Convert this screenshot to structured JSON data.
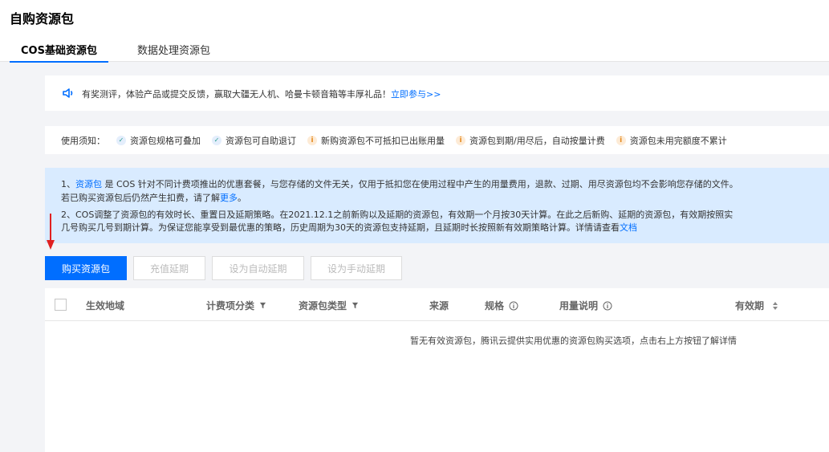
{
  "header": {
    "title": "自购资源包",
    "tabs": [
      {
        "label": "COS基础资源包"
      },
      {
        "label": "数据处理资源包"
      }
    ]
  },
  "announcement": {
    "text": "有奖测评，体验产品或提交反馈，赢取大疆无人机、哈曼卡顿音箱等丰厚礼品！",
    "link": "立即参与>>"
  },
  "notice": {
    "label": "使用须知：",
    "items": [
      {
        "text": "资源包规格可叠加",
        "icon": "check-icon"
      },
      {
        "text": "资源包可自助退订",
        "icon": "check-icon"
      },
      {
        "text": "新购资源包不可抵扣已出账用量",
        "icon": "info-icon"
      },
      {
        "text": "资源包到期/用尽后，自动按量计费",
        "icon": "info-icon"
      },
      {
        "text": "资源包未用完额度不累计",
        "icon": "info-icon"
      }
    ]
  },
  "info": {
    "l1_prefix": "1、",
    "l1_link": "资源包",
    "l1_text": " 是 COS 针对不同计费项推出的优惠套餐，与您存储的文件无关，仅用于抵扣您在使用过程中产生的用量费用，退款、过期、用尽资源包均不会影响您存储的文件。",
    "l2_text": "若已购买资源包后仍然产生扣费，请了解",
    "l2_link": "更多",
    "l2_end": "。",
    "l3_text": "2、COS调整了资源包的有效时长、重置日及延期策略。在2021.12.1之前新购以及延期的资源包，有效期一个月按30天计算。在此之后新购、延期的资源包，有效期按照实",
    "l4_text": "几号购买几号到期计算。为保证您能享受到最优惠的策略，历史周期为30天的资源包支持延期，且延期时长按照新有效期策略计算。详情请查看",
    "l4_link": "文档"
  },
  "buttons": {
    "buy": "购买资源包",
    "renew": "充值延期",
    "auto_renew": "设为自动延期",
    "manual_renew": "设为手动延期"
  },
  "table": {
    "columns": [
      "生效地域",
      "计费项分类",
      "资源包类型",
      "来源",
      "规格",
      "用量说明",
      "有效期"
    ],
    "empty_text": "暂无有效资源包，腾讯云提供实用优惠的资源包购买选项，点击右上方按钮了解详情"
  },
  "colors": {
    "primary": "#006eff",
    "info_bg": "#d9ebff",
    "arrow": "#e02020"
  }
}
